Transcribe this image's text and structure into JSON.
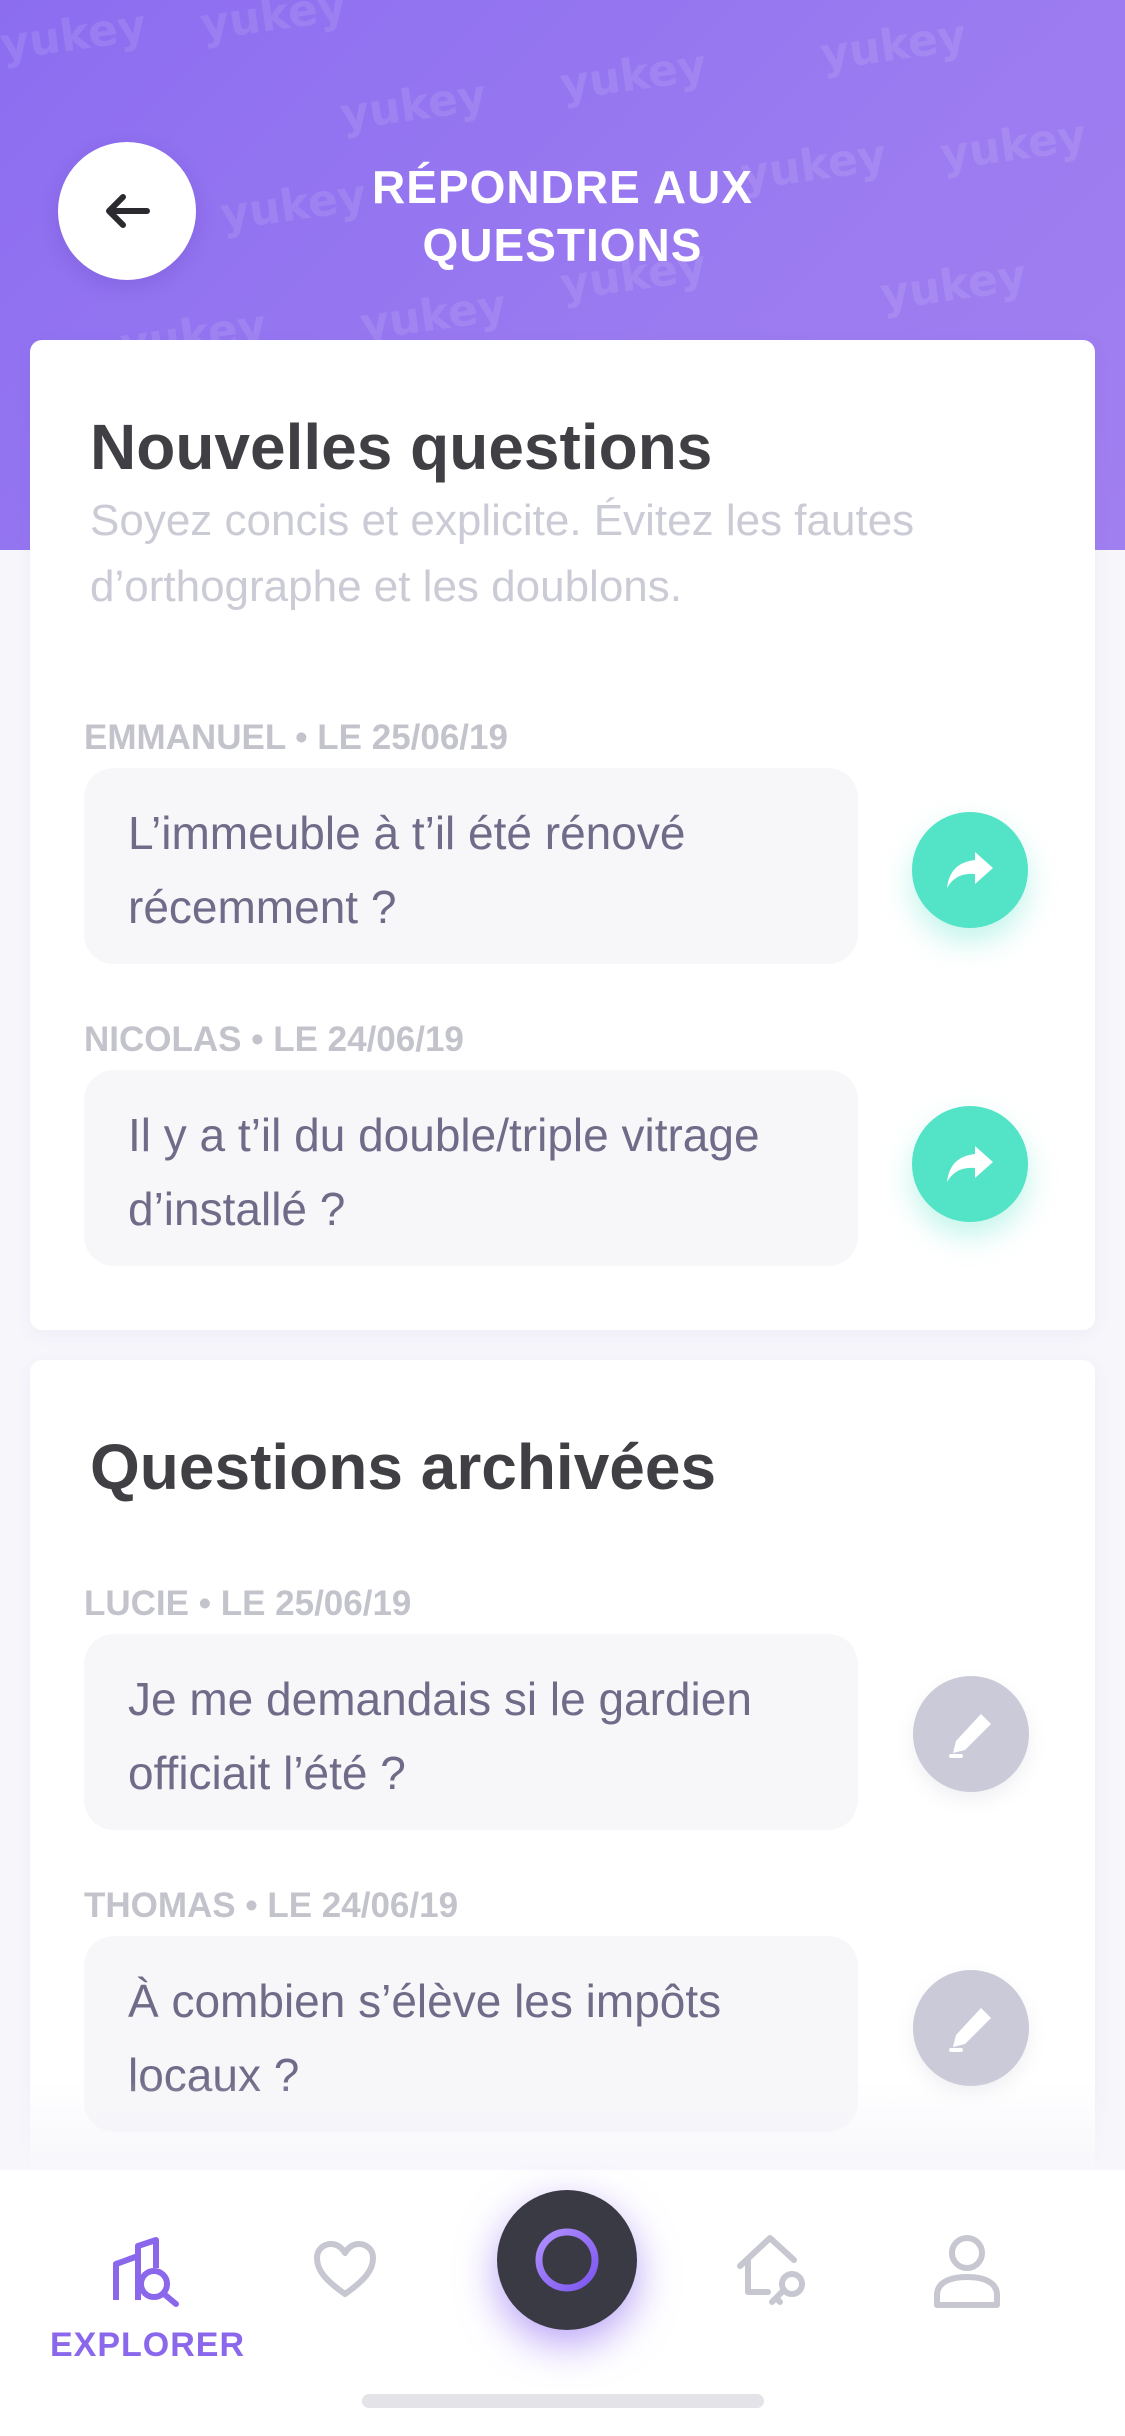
{
  "header": {
    "title": "RÉPONDRE AUX QUESTIONS",
    "watermark": "yukey",
    "back_icon": "arrow-left-icon",
    "colors": {
      "primary": "#8c6df0",
      "accent": "#53e3c6"
    }
  },
  "new_questions": {
    "heading": "Nouvelles questions",
    "subtitle": "Soyez concis et explicite. Évitez les fautes d’orthographe et les doublons.",
    "items": [
      {
        "meta": "EMMANUEL • LE 25/06/19",
        "text": "L’immeuble à t’il été rénové récemment ?",
        "action_icon": "share-forward-icon"
      },
      {
        "meta": "NICOLAS • LE 24/06/19",
        "text": "Il y a t’il du double/triple vitrage d’installé ?",
        "action_icon": "share-forward-icon"
      }
    ]
  },
  "archived_questions": {
    "heading": "Questions archivées",
    "items": [
      {
        "meta": "LUCIE • LE 25/06/19",
        "text": "Je me demandais si le gardien officiait l’été ?",
        "action_icon": "pen-icon"
      },
      {
        "meta": "THOMAS • LE 24/06/19",
        "text": "À combien s’élève les impôts locaux ?",
        "action_icon": "pen-icon"
      }
    ]
  },
  "tabbar": {
    "active_label": "EXPLORER",
    "tabs": [
      "explore-icon",
      "heart-icon",
      "center-ring-icon",
      "home-key-icon",
      "user-icon"
    ]
  }
}
